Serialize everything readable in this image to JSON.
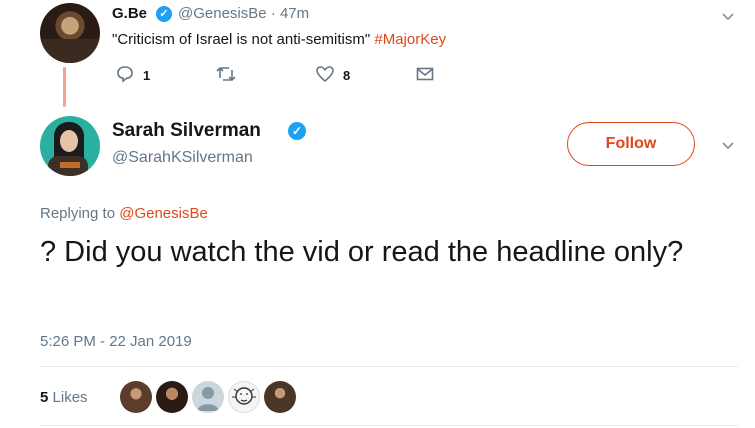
{
  "parent_tweet": {
    "display_name": "G.Be",
    "handle": "@GenesisBe",
    "time_ago": "· 47m",
    "text": "\"Criticism of Israel is not anti-semitism\"",
    "hashtag": "#MajorKey",
    "reply_count": "1",
    "like_count": "8",
    "icons": [
      "reply-icon",
      "retweet-icon",
      "like-icon",
      "message-icon",
      "chevron-down-icon"
    ]
  },
  "main_tweet": {
    "display_name": "Sarah Silverman",
    "handle": "@SarahKSilverman",
    "follow_label": "Follow",
    "replying_prefix": "Replying to",
    "replying_to": "@GenesisBe",
    "text": "? Did you watch the vid or read the headline only?",
    "timestamp": "5:26 PM - 22 Jan 2019",
    "likes_count": "5",
    "likes_label": "Likes"
  },
  "colors": {
    "accent": "#e0471b",
    "verified": "#1da1f2",
    "muted": "#657786",
    "thread_line": "#f2a58a",
    "divider": "#e6ecf0"
  }
}
